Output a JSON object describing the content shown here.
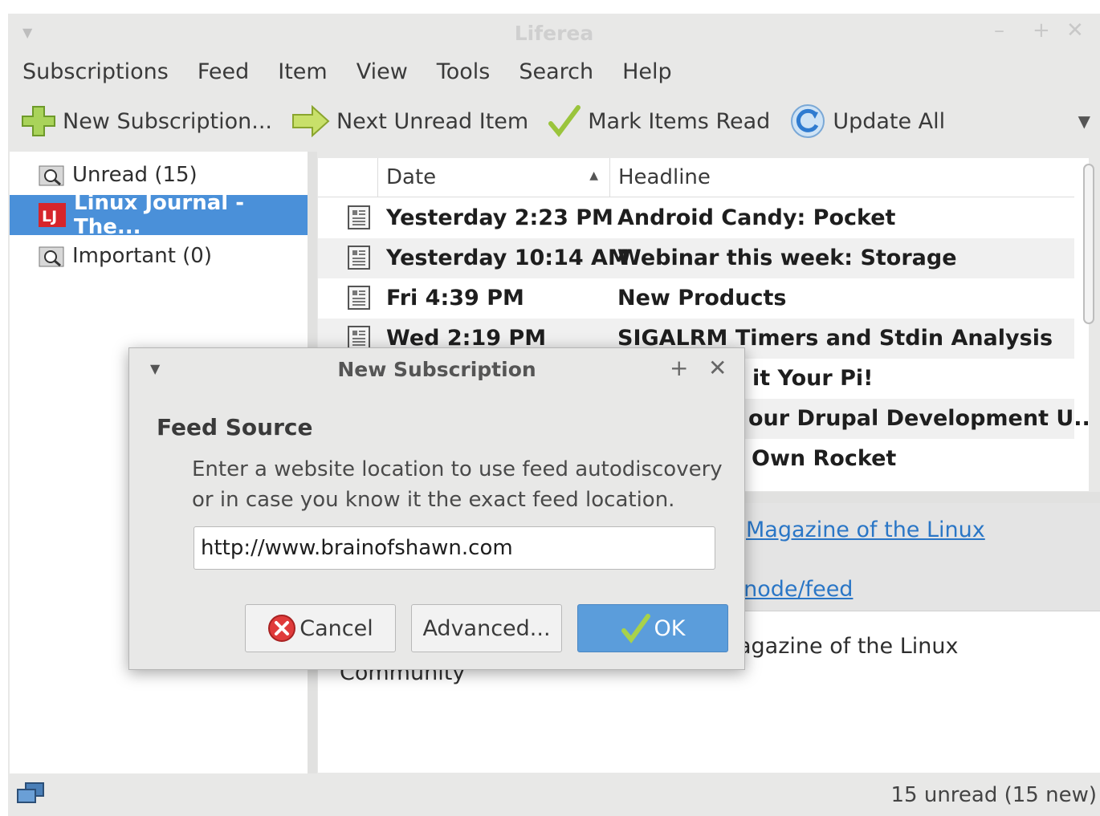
{
  "window": {
    "title": "Liferea"
  },
  "menubar": {
    "items": [
      "Subscriptions",
      "Feed",
      "Item",
      "View",
      "Tools",
      "Search",
      "Help"
    ]
  },
  "toolbar": {
    "new_subscription": "New Subscription...",
    "next_unread": "Next Unread Item",
    "mark_read": "Mark Items Read",
    "update_all": "Update All"
  },
  "sidebar": {
    "items": [
      {
        "label": "Unread (15)",
        "icon": "search-folder-icon"
      },
      {
        "label": "Linux Journal - The...",
        "icon": "lj-feed-icon",
        "selected": true
      },
      {
        "label": "Important (0)",
        "icon": "search-folder-icon"
      }
    ]
  },
  "headlines": {
    "columns": {
      "date": "Date",
      "headline": "Headline"
    },
    "rows": [
      {
        "date": "Yesterday 2:23 PM",
        "headline": "Android Candy: Pocket"
      },
      {
        "date": "Yesterday 10:14 AM",
        "headline": "Webinar this week: Storage"
      },
      {
        "date": "Fri 4:39 PM",
        "headline": "New Products"
      },
      {
        "date": "Wed 2:19 PM",
        "headline": "SIGALRM Timers and Stdin Analysis"
      },
      {
        "date": "",
        "headline": "it Your Pi!"
      },
      {
        "date": "",
        "headline": "our Drupal Development U..."
      },
      {
        "date": "",
        "headline": "Own Rocket"
      }
    ]
  },
  "itemview": {
    "link1": "Magazine of the Linux",
    "link2": "/node/feed",
    "desc1": "agazine of the Linux",
    "desc2": "Community"
  },
  "status": {
    "text": "15 unread (15 new)"
  },
  "dialog": {
    "title": "New Subscription",
    "section_title": "Feed Source",
    "instructions": "Enter a website location to use feed autodiscovery or in case you know it the exact feed location.",
    "url_value": "http://www.brainofshawn.com",
    "cancel_label": "Cancel",
    "advanced_label": "Advanced...",
    "ok_label": "OK"
  },
  "colors": {
    "selection": "#4a90d9",
    "ok_button": "#5b9ddb",
    "link": "#2a76c6"
  }
}
